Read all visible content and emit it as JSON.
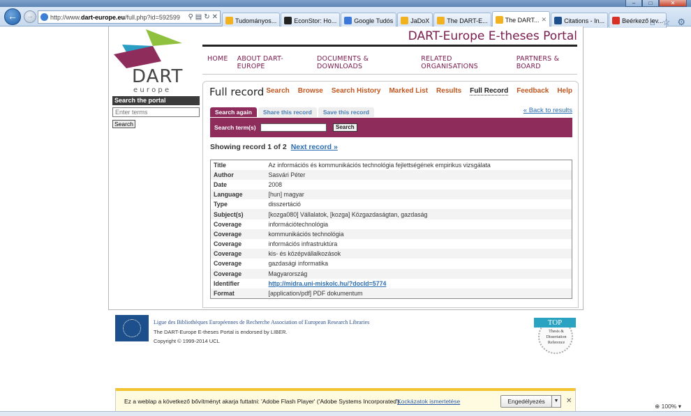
{
  "browser": {
    "url_prefix": "http://www.",
    "url_host": "dart-europe.eu",
    "url_path": "/full.php?id=592599",
    "tabs": [
      {
        "label": "Tudományos...",
        "icon_color": "#f2b21f",
        "active": false
      },
      {
        "label": "EconStor: Ho...",
        "icon_color": "#222222",
        "active": false
      },
      {
        "label": "Google Tudós",
        "icon_color": "#3b78d8",
        "active": false
      },
      {
        "label": "JaDoX",
        "icon_color": "#f2b21f",
        "active": false
      },
      {
        "label": "The DART-E...",
        "icon_color": "#f2b21f",
        "active": false
      },
      {
        "label": "The DART...",
        "icon_color": "#f2b21f",
        "active": true
      },
      {
        "label": "Citations - In...",
        "icon_color": "#1d4f8c",
        "active": false
      },
      {
        "label": "Beérkező lev...",
        "icon_color": "#d93025",
        "active": false
      }
    ],
    "zoom": "100%"
  },
  "site": {
    "portal_title": "DART-Europe E-theses Portal",
    "logo_text": "DART",
    "logo_subtext": "e u r o p e",
    "main_nav": [
      "HOME",
      "ABOUT DART-EUROPE",
      "DOCUMENTS & DOWNLOADS",
      "RELATED ORGANISATIONS",
      "PARTNERS & BOARD"
    ]
  },
  "sidebar": {
    "heading": "Search the portal",
    "input_placeholder": "Enter terms",
    "button_label": "Search"
  },
  "content": {
    "title": "Full record",
    "subnav": [
      "Search",
      "Browse",
      "Search History",
      "Marked List",
      "Results",
      "Full Record",
      "Feedback",
      "Help"
    ],
    "current_subnav": "Full Record",
    "form_tabs": [
      "Search again",
      "Share this record",
      "Save this record"
    ],
    "back_link": "« Back to results",
    "search_label": "Search term(s)",
    "search_button": "Search",
    "showing": "Showing record 1 of 2",
    "next_link": "Next record »"
  },
  "record": [
    {
      "key": "Title",
      "value": "Az információs és kommunikációs technológia fejlettségének empirikus vizsgálata"
    },
    {
      "key": "Author",
      "value": "Sasvári Péter"
    },
    {
      "key": "Date",
      "value": "2008"
    },
    {
      "key": "Language",
      "value": "[hun] magyar"
    },
    {
      "key": "Type",
      "value": "disszertáció"
    },
    {
      "key": "Subject(s)",
      "value": "[kozga080] Vállalatok, [kozga] Közgazdaságtan, gazdaság"
    },
    {
      "key": "Coverage",
      "value": "információtechnológia"
    },
    {
      "key": "Coverage",
      "value": "kommunikációs technológia"
    },
    {
      "key": "Coverage",
      "value": "információs infrastruktúra"
    },
    {
      "key": "Coverage",
      "value": "kis- és középvállalkozások"
    },
    {
      "key": "Coverage",
      "value": "gazdasági informatika"
    },
    {
      "key": "Coverage",
      "value": "Magyarország"
    },
    {
      "key": "Identifier",
      "value": "http://midra.uni-miskolc.hu/?docId=5774",
      "link": true
    },
    {
      "key": "Format",
      "value": "[application/pdf] PDF dokumentum"
    }
  ],
  "footer": {
    "line1": "Ligue des Bibliothèques Européennes de Recherche Association of European Research Libraries",
    "line2": "The DART-Europe E-theses Portal is endorsed by LIBER.",
    "line3": "Copyright © 1999-2014 UCL",
    "badge_top": "TOP",
    "badge_sub": "Thesis & Dissertation Reference"
  },
  "notification": {
    "message": "Ez a weblap a következő bővítményt akarja futtatni: 'Adobe Flash Player' ('Adobe Systems Incorporated').",
    "risk_link": "Kockázatok ismertetése",
    "allow_button": "Engedélyezés"
  },
  "colors": {
    "brand": "#8e2c5c",
    "link": "#2a6cb0",
    "subnav": "#c0561f"
  }
}
